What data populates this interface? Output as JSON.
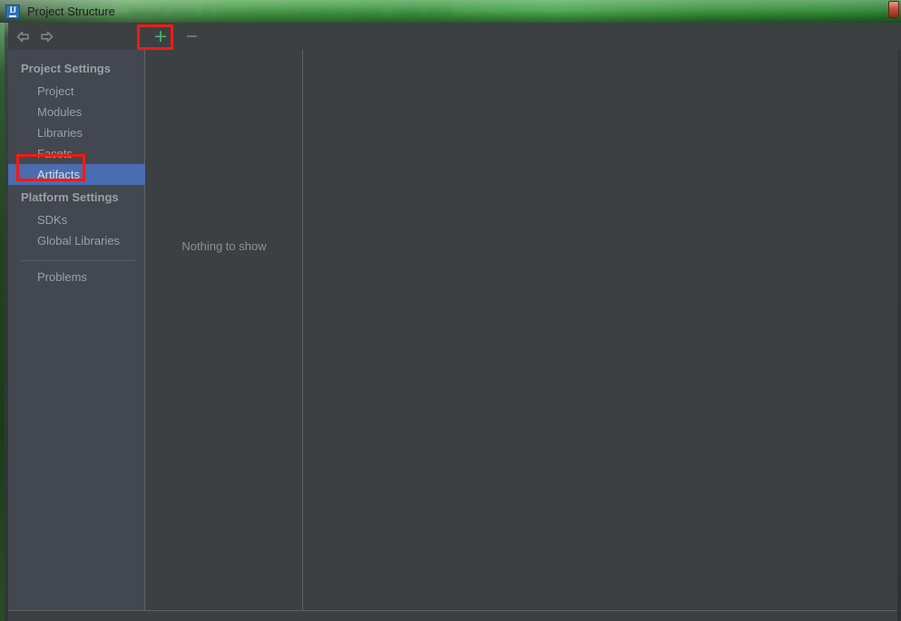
{
  "window": {
    "title": "Project Structure",
    "app_icon_label": "IJ",
    "title_blurred_text": "SpringProject  -  [C:\\Users\\Administrator\\IdeaProjects]  -  IntelliJ IDEA",
    "close_button_label": "×"
  },
  "toolbar": {
    "back_icon": "arrow-left-icon",
    "forward_icon": "arrow-right-icon",
    "add_label": "+",
    "remove_label": "−"
  },
  "sidebar": {
    "groups": [
      {
        "heading": "Project Settings",
        "items": [
          {
            "label": "Project",
            "selected": false
          },
          {
            "label": "Modules",
            "selected": false
          },
          {
            "label": "Libraries",
            "selected": false
          },
          {
            "label": "Facets",
            "selected": false
          },
          {
            "label": "Artifacts",
            "selected": true
          }
        ]
      },
      {
        "heading": "Platform Settings",
        "items": [
          {
            "label": "SDKs",
            "selected": false
          },
          {
            "label": "Global Libraries",
            "selected": false
          }
        ]
      }
    ],
    "footer_items": [
      {
        "label": "Problems",
        "selected": false
      }
    ]
  },
  "main": {
    "empty_message": "Nothing to show"
  },
  "annotations": [
    {
      "name": "add-artifact-highlight",
      "target": "add-button"
    },
    {
      "name": "artifacts-item-highlight",
      "target": "sidebar-item-artifacts"
    }
  ],
  "colors": {
    "titlebar_green": "#3f9a43",
    "selection_blue": "#4a6cb0",
    "panel_bg": "#3c4043",
    "sidebar_bg": "#434750",
    "annotation_red": "#f41b10",
    "plus_green": "#3fc46a",
    "text_muted": "#9aa0a6"
  }
}
